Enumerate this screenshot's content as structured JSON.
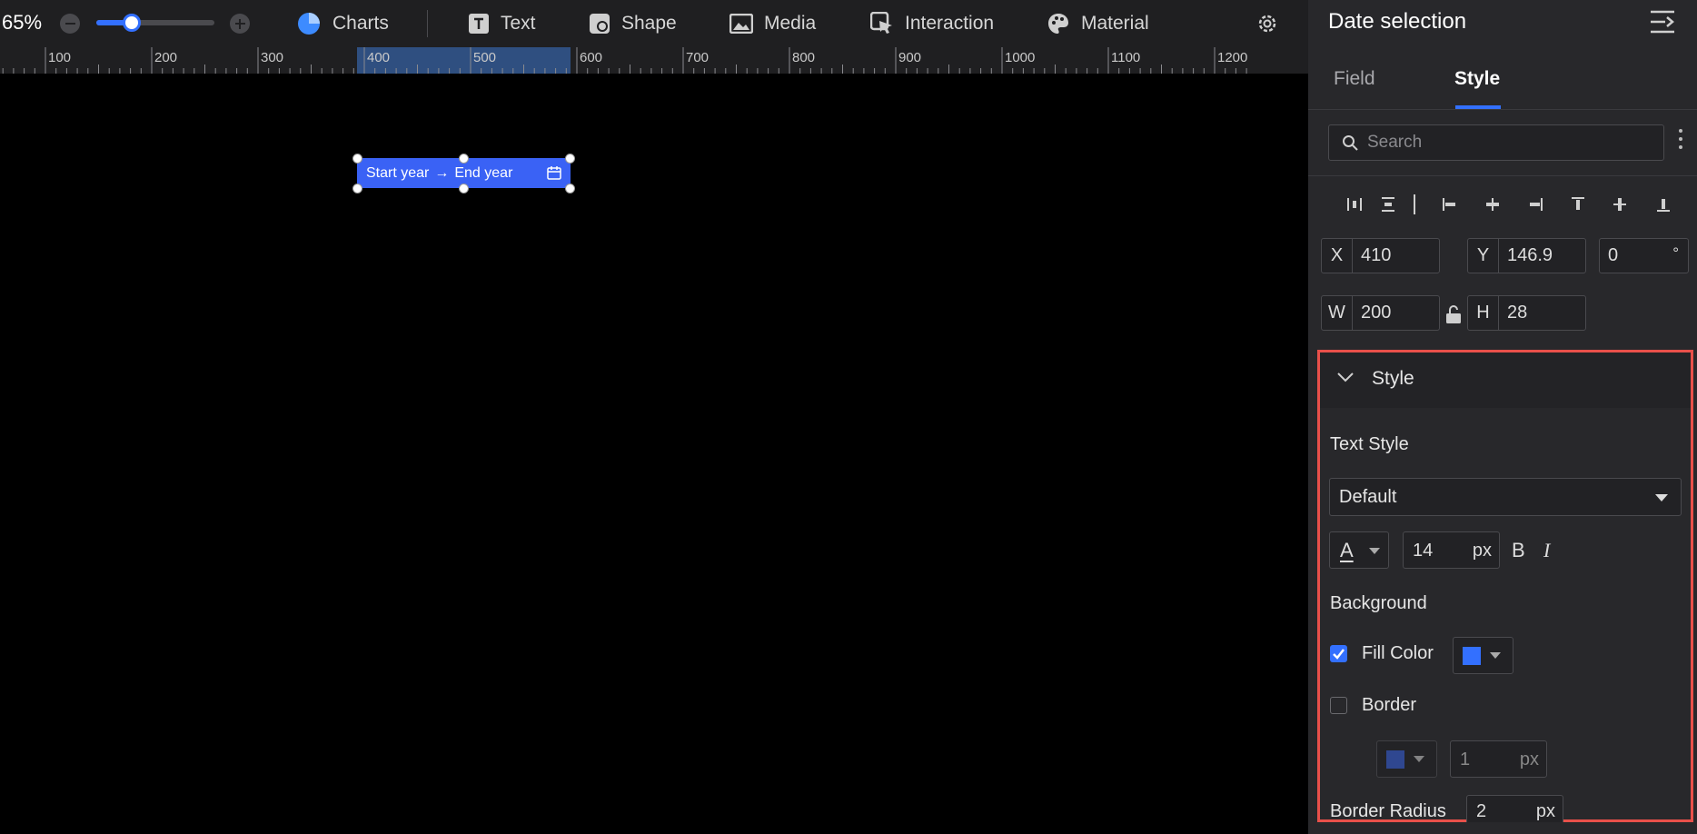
{
  "toolbar": {
    "zoom": "65%",
    "zoom_fraction": 0.3,
    "tools": [
      {
        "label": "Charts",
        "icon": "pie-chart-icon"
      },
      {
        "label": "Text",
        "icon": "text-icon"
      },
      {
        "label": "Shape",
        "icon": "shape-icon"
      },
      {
        "label": "Media",
        "icon": "image-icon"
      },
      {
        "label": "Interaction",
        "icon": "cursor-click-icon"
      },
      {
        "label": "Material",
        "icon": "palette-icon"
      }
    ],
    "settings_icon": "gear-icon"
  },
  "ruler": {
    "labels": [
      "100",
      "200",
      "300",
      "400",
      "500",
      "600",
      "700",
      "800",
      "900",
      "1000",
      "1100",
      "1200"
    ]
  },
  "canvas": {
    "widget": {
      "start_label": "Start year",
      "arrow": "→",
      "end_label": "End year",
      "icon": "calendar-icon",
      "color": "#3a62f5"
    }
  },
  "panel": {
    "title": "Date selection",
    "tabs": [
      {
        "label": "Field",
        "active": false
      },
      {
        "label": "Style",
        "active": true
      }
    ],
    "search_placeholder": "Search",
    "position": {
      "x_label": "X",
      "x": "410",
      "y_label": "Y",
      "y": "146.9",
      "rotation": "0",
      "rotation_unit": "°",
      "w_label": "W",
      "w": "200",
      "h_label": "H",
      "h": "28"
    },
    "style": {
      "section_title": "Style",
      "text_style_label": "Text Style",
      "text_style_value": "Default",
      "font_color_glyph": "A",
      "font_size": "14",
      "font_unit": "px",
      "bold": "B",
      "italic": "I",
      "background_label": "Background",
      "fill_color_label": "Fill Color",
      "fill_checked": true,
      "fill_color": "#3370ff",
      "border_label": "Border",
      "border_checked": false,
      "border_color": "#3355bb",
      "border_width": "1",
      "border_unit": "px",
      "border_radius_label": "Border Radius",
      "border_radius": "2",
      "border_radius_unit": "px"
    }
  },
  "colors": {
    "accent": "#3370ff",
    "highlight": "#e8504a"
  }
}
